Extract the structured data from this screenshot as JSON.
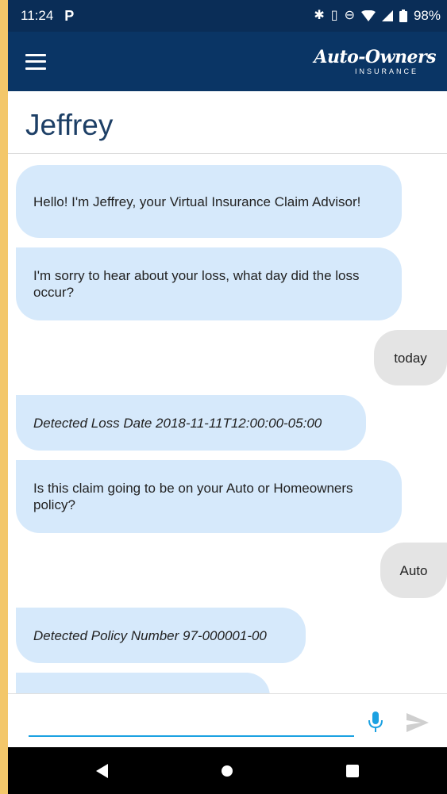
{
  "status_bar": {
    "time": "11:24",
    "battery": "98%",
    "icons": [
      "parking-icon",
      "bluetooth-icon",
      "vibrate-icon",
      "do-not-disturb-icon",
      "wifi-icon",
      "signal-icon",
      "battery-icon"
    ]
  },
  "app_bar": {
    "menu_icon": "hamburger-menu-icon",
    "logo_brand": "Auto-Owners",
    "logo_sub": "INSURANCE"
  },
  "title": "Jeffrey",
  "messages": [
    {
      "sender": "bot",
      "text": "Hello! I'm Jeffrey, your Virtual Insurance Claim Advisor!"
    },
    {
      "sender": "bot",
      "text": "I'm sorry to hear about your loss, what day did the loss occur?"
    },
    {
      "sender": "user",
      "text": "today"
    },
    {
      "sender": "bot",
      "text": "Detected Loss Date 2018-11-11T12:00:00-05:00",
      "italic": true
    },
    {
      "sender": "bot",
      "text": "Is this claim going to be on your Auto or Homeowners policy?"
    },
    {
      "sender": "user",
      "text": "Auto"
    },
    {
      "sender": "bot",
      "text": "Detected Policy Number 97-000001-00",
      "italic": true
    }
  ],
  "input": {
    "value": "",
    "placeholder": "",
    "mic_icon": "microphone-icon",
    "send_icon": "send-icon"
  },
  "colors": {
    "header_blue": "#0a3565",
    "bot_bubble": "#d6e9fb",
    "user_bubble": "#e4e4e4",
    "title_text": "#1d3f66",
    "accent": "#1ba1e2"
  },
  "nav_bar": {
    "icons": [
      "back-icon",
      "home-icon",
      "recents-icon"
    ]
  }
}
